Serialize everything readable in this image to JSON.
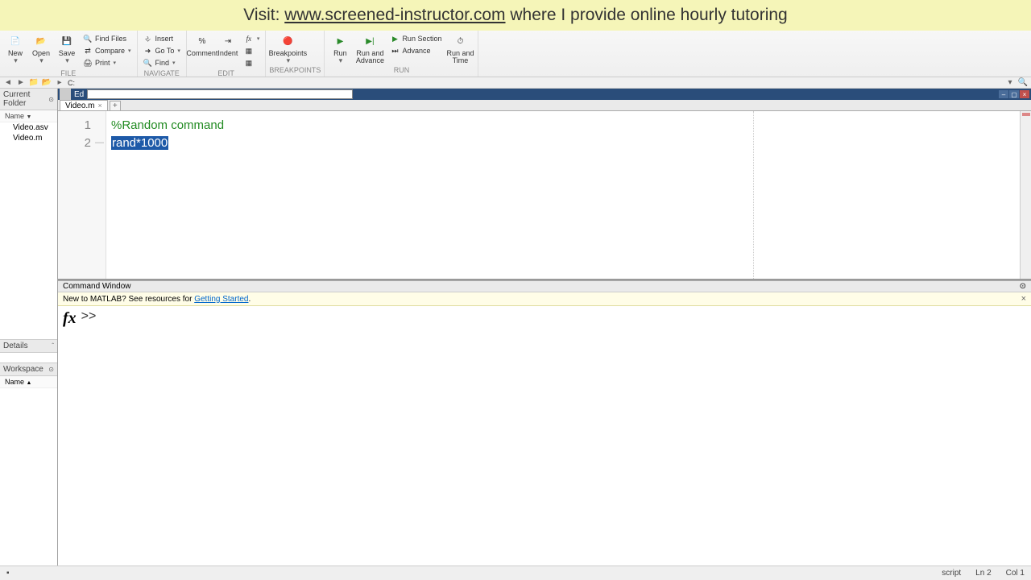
{
  "banner": {
    "prefix": "Visit: ",
    "url": "www.screened-instructor.com",
    "suffix": " where I provide online hourly tutoring"
  },
  "ribbon": {
    "file": {
      "new": "New",
      "open": "Open",
      "save": "Save",
      "find_files": "Find Files",
      "compare": "Compare",
      "print": "Print",
      "label": "FILE"
    },
    "navigate": {
      "insert": "Insert",
      "goto": "Go To",
      "find": "Find",
      "label": "NAVIGATE"
    },
    "edit": {
      "comment": "Comment",
      "indent": "Indent",
      "fx": "fx",
      "label": "EDIT"
    },
    "breakpoints": {
      "btn": "Breakpoints",
      "label": "BREAKPOINTS"
    },
    "run": {
      "run": "Run",
      "run_advance": "Run and\nAdvance",
      "run_section": "Run Section",
      "advance": "Advance",
      "run_time": "Run and\nTime",
      "label": "RUN"
    }
  },
  "address": {
    "path": "C:"
  },
  "current_folder": {
    "title": "Current Folder",
    "name_col": "Name",
    "files": [
      "Video.asv",
      "Video.m"
    ]
  },
  "details": {
    "title": "Details"
  },
  "workspace": {
    "title": "Workspace",
    "name_col": "Name"
  },
  "editor": {
    "title": "Ed",
    "tab": "Video.m",
    "lines": [
      {
        "n": "1",
        "text": "%Random command",
        "type": "comment"
      },
      {
        "n": "2",
        "text": "rand*1000",
        "type": "selected",
        "dash": "—"
      }
    ]
  },
  "command_window": {
    "title": "Command Window",
    "info_prefix": "New to MATLAB? See resources for ",
    "info_link": "Getting Started",
    "info_suffix": ".",
    "fx": "fx",
    "prompt": ">>"
  },
  "status": {
    "type": "script",
    "ln": "Ln 2",
    "col": "Col 1"
  }
}
